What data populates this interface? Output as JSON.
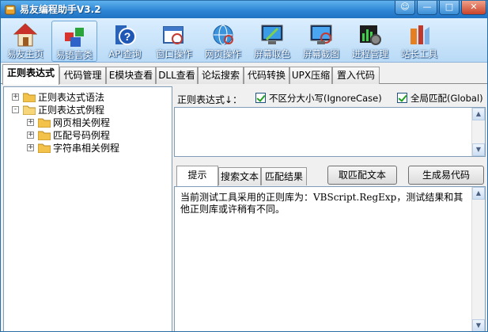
{
  "window": {
    "title": "易友编程助手V3.2",
    "controls": {
      "help": "☺",
      "minimize": "—",
      "maximize": "□",
      "close": "✕"
    }
  },
  "toolbar": {
    "items": [
      {
        "label": "易友主页",
        "icon": "home-icon"
      },
      {
        "label": "易语言类",
        "icon": "blocks-icon"
      },
      {
        "label": "API查询",
        "icon": "help-book-icon"
      },
      {
        "label": "窗口操作",
        "icon": "window-icon"
      },
      {
        "label": "网页操作",
        "icon": "globe-icon"
      },
      {
        "label": "屏幕取色",
        "icon": "color-picker-icon"
      },
      {
        "label": "屏幕截图",
        "icon": "screenshot-icon"
      },
      {
        "label": "进程管理",
        "icon": "process-gear-icon"
      },
      {
        "label": "站长工具",
        "icon": "tools-icon"
      }
    ]
  },
  "tabs": [
    {
      "label": "正则表达式"
    },
    {
      "label": "代码管理"
    },
    {
      "label": "E模块查看"
    },
    {
      "label": "DLL查看"
    },
    {
      "label": "论坛搜索"
    },
    {
      "label": "代码转换"
    },
    {
      "label": "UPX压缩"
    },
    {
      "label": "置入代码"
    }
  ],
  "tree": {
    "nodes": [
      {
        "label": "正则表达式语法",
        "expander": "+"
      },
      {
        "label": "正则表达式例程",
        "expander": "-"
      },
      {
        "label": "网页相关例程",
        "expander": "+"
      },
      {
        "label": "匹配号码例程",
        "expander": "+"
      },
      {
        "label": "字符串相关例程",
        "expander": "+"
      }
    ]
  },
  "regex": {
    "label": "正则表达式↓：",
    "ignore_case": "不区分大小写(IgnoreCase)",
    "global": "全局匹配(Global)",
    "value": ""
  },
  "subtabs": [
    {
      "label": "提示"
    },
    {
      "label": "搜索文本"
    },
    {
      "label": "匹配结果"
    }
  ],
  "buttons": {
    "match": "取匹配文本",
    "generate": "生成易代码"
  },
  "output": {
    "text": "当前测试工具采用的正则库为：VBScript.RegExp，测试结果和其他正则库或许稍有不同。"
  },
  "scroll_arrows": {
    "up": "▲",
    "down": "▼"
  },
  "colors": {
    "titlebar": "#2f86d4",
    "check": "#21a121",
    "accent": "#6fa7d9"
  }
}
